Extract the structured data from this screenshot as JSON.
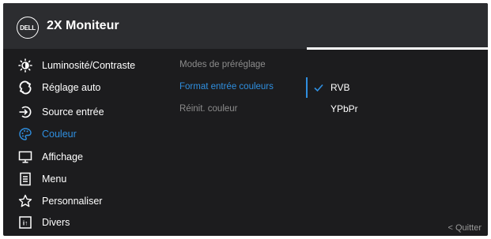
{
  "header": {
    "logo_text": "DELL",
    "title": "2X Moniteur"
  },
  "menu": {
    "items": [
      {
        "label": "Luminosité/Contraste",
        "icon": "brightness-icon"
      },
      {
        "label": "Réglage auto",
        "icon": "auto-adjust-icon"
      },
      {
        "label": "Source entrée",
        "icon": "input-source-icon"
      },
      {
        "label": "Couleur",
        "icon": "color-palette-icon",
        "active": true
      },
      {
        "label": "Affichage",
        "icon": "display-icon"
      },
      {
        "label": "Menu",
        "icon": "menu-doc-icon"
      },
      {
        "label": "Personnaliser",
        "icon": "star-icon"
      },
      {
        "label": "Divers",
        "icon": "others-icon"
      }
    ]
  },
  "submenu": {
    "items": [
      {
        "label": "Modes de préréglage"
      },
      {
        "label": "Format entrée couleurs",
        "active": true
      },
      {
        "label": "Réinit. couleur"
      }
    ]
  },
  "options": {
    "items": [
      {
        "label": "RVB",
        "selected": true
      },
      {
        "label": "YPbPr",
        "selected": false
      }
    ]
  },
  "footer": {
    "quit_label": "< Quitter"
  },
  "colors": {
    "accent": "#2f8fe0",
    "background": "#1c1c1e",
    "header": "#2c2d30",
    "muted_text": "#8c8c8c"
  }
}
